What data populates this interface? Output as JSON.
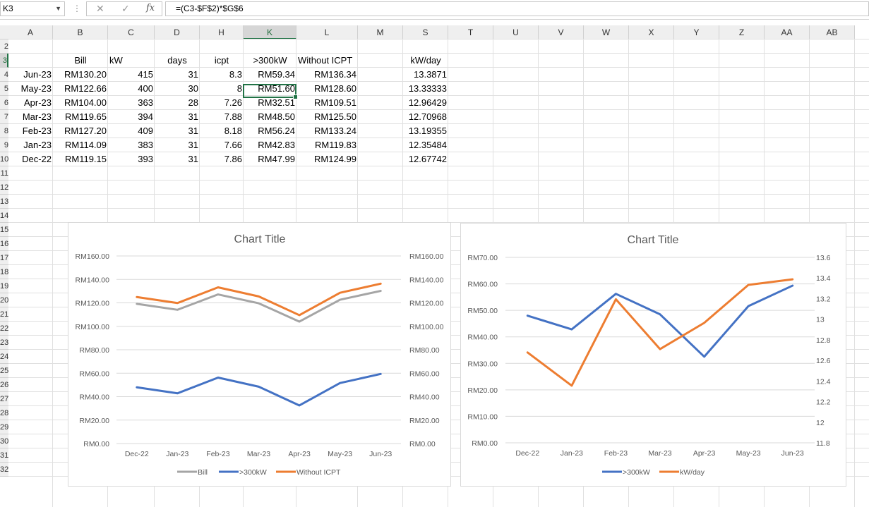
{
  "formula_bar": {
    "name_box": "K3",
    "formula": "=(C3-$F$2)*$G$6",
    "fx": "fx"
  },
  "columns": [
    "A",
    "B",
    "C",
    "D",
    "H",
    "K",
    "L",
    "M",
    "S",
    "T",
    "U",
    "V",
    "W",
    "X",
    "Y",
    "Z",
    "AA",
    "AB"
  ],
  "rows": [
    "",
    "2",
    "3",
    "4",
    "5",
    "6",
    "7",
    "8",
    "9",
    "10",
    "11",
    "12",
    "13",
    "14",
    "15",
    "16",
    "17",
    "18",
    "19",
    "20",
    "21",
    "22",
    "23",
    "24",
    "25",
    "26",
    "27",
    "28",
    "29",
    "30",
    "31",
    "32"
  ],
  "table": {
    "headers": {
      "bill": "Bill",
      "kw": "kW",
      "days": "days",
      "icpt": "icpt",
      "over300": ">300kW",
      "without": "Without ICPT",
      "kwday": "kW/day"
    },
    "rows": [
      {
        "month": "Jun-23",
        "bill": "RM130.20",
        "kw": "415",
        "days": "31",
        "icpt": "8.3",
        "over300": "RM59.34",
        "without": "RM136.34",
        "kwday": "13.3871"
      },
      {
        "month": "May-23",
        "bill": "RM122.66",
        "kw": "400",
        "days": "30",
        "icpt": "8",
        "over300": "RM51.60",
        "without": "RM128.60",
        "kwday": "13.33333"
      },
      {
        "month": "Apr-23",
        "bill": "RM104.00",
        "kw": "363",
        "days": "28",
        "icpt": "7.26",
        "over300": "RM32.51",
        "without": "RM109.51",
        "kwday": "12.96429"
      },
      {
        "month": "Mar-23",
        "bill": "RM119.65",
        "kw": "394",
        "days": "31",
        "icpt": "7.88",
        "over300": "RM48.50",
        "without": "RM125.50",
        "kwday": "12.70968"
      },
      {
        "month": "Feb-23",
        "bill": "RM127.20",
        "kw": "409",
        "days": "31",
        "icpt": "8.18",
        "over300": "RM56.24",
        "without": "RM133.24",
        "kwday": "13.19355"
      },
      {
        "month": "Jan-23",
        "bill": "RM114.09",
        "kw": "383",
        "days": "31",
        "icpt": "7.66",
        "over300": "RM42.83",
        "without": "RM119.83",
        "kwday": "12.35484"
      },
      {
        "month": "Dec-22",
        "bill": "RM119.15",
        "kw": "393",
        "days": "31",
        "icpt": "7.86",
        "over300": "RM47.99",
        "without": "RM124.99",
        "kwday": "12.67742"
      }
    ]
  },
  "chart_data": [
    {
      "type": "line",
      "title": "Chart Title",
      "categories": [
        "Dec-22",
        "Jan-23",
        "Feb-23",
        "Mar-23",
        "Apr-23",
        "May-23",
        "Jun-23"
      ],
      "ylim": [
        0,
        160
      ],
      "yticks": [
        "RM0.00",
        "RM20.00",
        "RM40.00",
        "RM60.00",
        "RM80.00",
        "RM100.00",
        "RM120.00",
        "RM140.00",
        "RM160.00"
      ],
      "secondary_yticks": [
        "RM0.00",
        "RM20.00",
        "RM40.00",
        "RM60.00",
        "RM80.00",
        "RM100.00",
        "RM120.00",
        "RM140.00",
        "RM160.00"
      ],
      "legend_position": "bottom",
      "series": [
        {
          "name": "Bill",
          "color": "#a5a5a5",
          "values": [
            119.15,
            114.09,
            127.2,
            119.65,
            104.0,
            122.66,
            130.2
          ]
        },
        {
          "name": ">300kW",
          "color": "#4472c4",
          "values": [
            47.99,
            42.83,
            56.24,
            48.5,
            32.51,
            51.6,
            59.34
          ]
        },
        {
          "name": "Without ICPT",
          "color": "#ed7d31",
          "values": [
            124.99,
            119.83,
            133.24,
            125.5,
            109.51,
            128.6,
            136.34
          ]
        }
      ]
    },
    {
      "type": "line",
      "title": "Chart Title",
      "categories": [
        "Dec-22",
        "Jan-23",
        "Feb-23",
        "Mar-23",
        "Apr-23",
        "May-23",
        "Jun-23"
      ],
      "ylim": [
        0,
        70
      ],
      "yticks": [
        "RM0.00",
        "RM10.00",
        "RM20.00",
        "RM30.00",
        "RM40.00",
        "RM50.00",
        "RM60.00",
        "RM70.00"
      ],
      "secondary_ylim": [
        11.8,
        13.6
      ],
      "secondary_yticks": [
        "11.8",
        "12",
        "12.2",
        "12.4",
        "12.6",
        "12.8",
        "13",
        "13.2",
        "13.4",
        "13.6"
      ],
      "legend_position": "bottom",
      "series": [
        {
          "name": ">300kW",
          "color": "#4472c4",
          "axis": "primary",
          "values": [
            47.99,
            42.83,
            56.24,
            48.5,
            32.51,
            51.6,
            59.34
          ]
        },
        {
          "name": "kW/day",
          "color": "#ed7d31",
          "axis": "secondary",
          "values": [
            12.67742,
            12.35484,
            13.19355,
            12.70968,
            12.96429,
            13.33333,
            13.3871
          ]
        }
      ]
    }
  ]
}
